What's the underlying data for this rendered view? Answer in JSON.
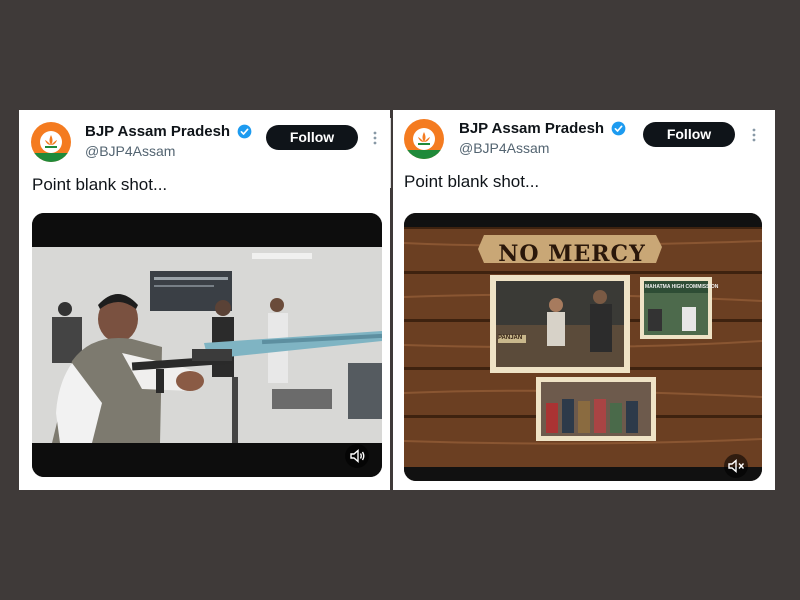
{
  "tweets": [
    {
      "author": "BJP Assam Pradesh",
      "handle": "@BJP4Assam",
      "follow_label": "Follow",
      "text": "Point blank shot...",
      "media": {
        "type": "video",
        "poster_sign": "Features of a Competition Rifle for Pistol",
        "muted": false
      }
    },
    {
      "author": "BJP Assam Pradesh",
      "handle": "@BJP4Assam",
      "follow_label": "Follow",
      "text": "Point blank shot...",
      "media": {
        "type": "video",
        "title_card": "NO MERCY",
        "frame_labels": [
          "PANJAN",
          "MAHATMA HIGH COMMISSION"
        ],
        "muted": true
      }
    }
  ],
  "colors": {
    "background": "#3f3a39",
    "card": "#ffffff",
    "text": "#0f1419",
    "handle": "#536471",
    "follow_bg": "#0f1419",
    "verified": "#1d9bf0",
    "avatar_orange": "#f47b20",
    "avatar_green": "#1f8a3a"
  },
  "icons": [
    "verified-badge-icon",
    "more-options-icon",
    "volume-icon",
    "muted-icon",
    "lotus-logo-icon"
  ]
}
